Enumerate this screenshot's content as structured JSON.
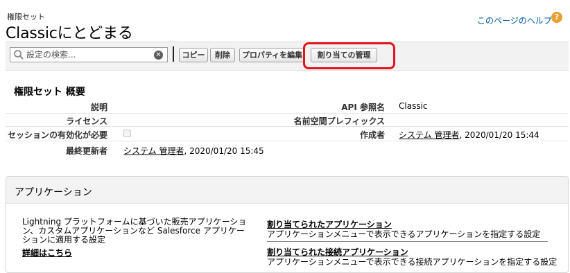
{
  "header": {
    "subtitle": "権限セット",
    "title": "Classicにとどまる",
    "help_label": "このページのヘルプ"
  },
  "toolbar": {
    "search_placeholder": "設定の検索...",
    "buttons": {
      "copy": "コピー",
      "delete": "削除",
      "edit_properties": "プロパティを編集",
      "manage_assignments": "割り当ての管理"
    }
  },
  "overview": {
    "title": "権限セット 概要",
    "fields": {
      "description_label": "説明",
      "description_value": "",
      "license_label": "ライセンス",
      "license_value": "",
      "session_activation_label": "セッションの有効化が必要",
      "last_modified_label": "最終更新者",
      "last_modified_user": "システム 管理者",
      "last_modified_date": ", 2020/01/20 15:45",
      "api_name_label": "API 参照名",
      "api_name_value": "Classic",
      "namespace_label": "名前空間プレフィックス",
      "namespace_value": "",
      "created_by_label": "作成者",
      "created_by_user": "システム 管理者",
      "created_by_date": ", 2020/01/20 15:44"
    },
    "session_activation_checked": false
  },
  "apps": {
    "title": "アプリケーション",
    "description": "Lightning プラットフォームに基づいた販売アプリケーション、カスタムアプリケーションなど Salesforce アプリケーションに適用する設定",
    "details_link": "詳細はこちら",
    "items": [
      {
        "link": "割り当てられたアプリケーション",
        "desc": "アプリケーションメニューで表示できるアプリケーションを指定する設定"
      },
      {
        "link": "割り当てられた接続アプリケーション",
        "desc": "アプリケーションメニューで表示できる接続アプリケーションを指定する設定"
      }
    ]
  },
  "colors": {
    "highlight": "#e3151c",
    "help_link": "#015ba7",
    "help_icon": "#e8a02e"
  }
}
